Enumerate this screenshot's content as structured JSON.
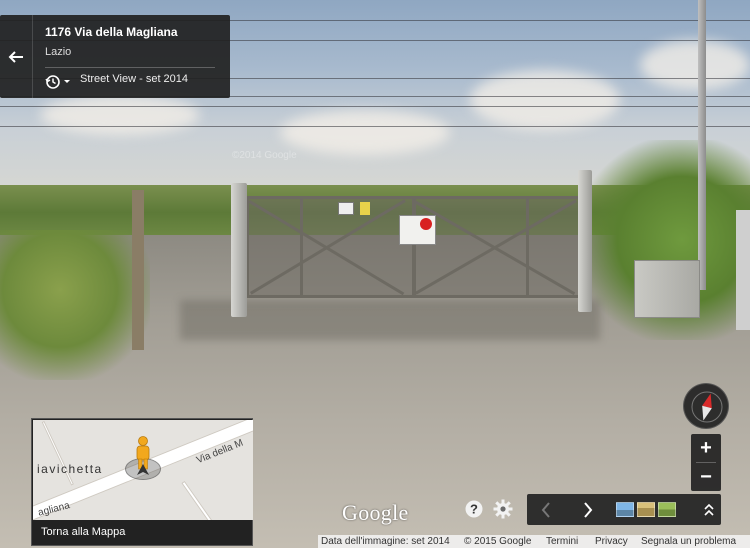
{
  "location": {
    "address": "1176 Via della Magliana",
    "region": "Lazio",
    "street_view_date": "Street View - set 2014"
  },
  "scene": {
    "faint_watermark": "©2014 Google"
  },
  "mini_map": {
    "road_label_1": "Via della M",
    "road_label_2": "agliana",
    "place_label": "iavichetta",
    "caption": "Torna alla Mappa"
  },
  "branding": {
    "google_logo": "Google"
  },
  "controls": {
    "zoom_in": "+",
    "zoom_out": "−",
    "help": "?",
    "compass_icon": "compass-icon",
    "settings_icon": "gear-icon"
  },
  "footer": {
    "image_date": "Data dell'immagine: set 2014",
    "copyright": "© 2015 Google",
    "terms": "Termini",
    "privacy": "Privacy",
    "report": "Segnala un problema"
  },
  "colors": {
    "panel_bg": "#212121",
    "compass_red": "#d92a2a",
    "pegman_orange": "#f2a81d"
  }
}
